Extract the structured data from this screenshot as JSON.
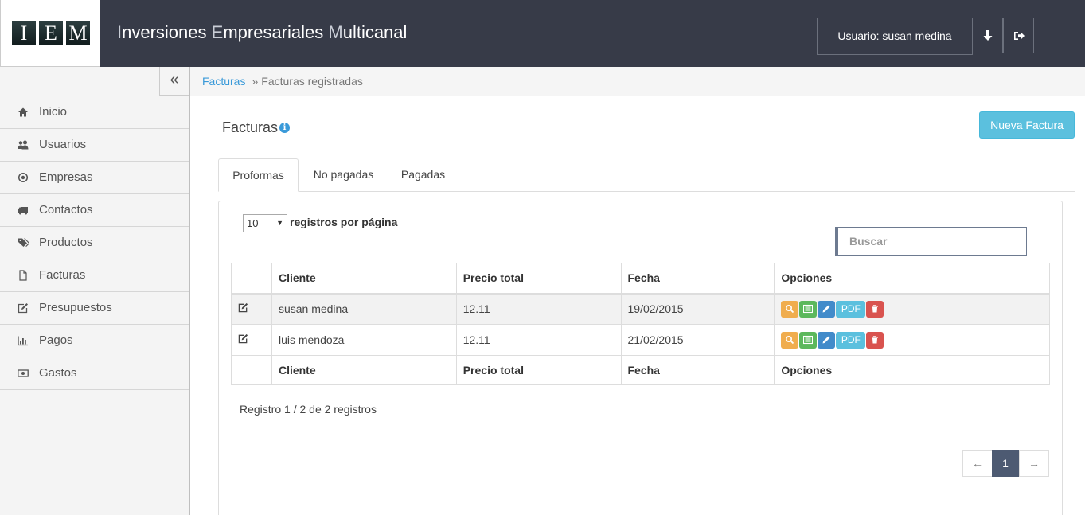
{
  "header": {
    "logo_letters": [
      "I",
      "E",
      "M"
    ],
    "title_parts": [
      {
        "cap": "I",
        "rest": "nversiones "
      },
      {
        "cap": "E",
        "rest": "mpresariales "
      },
      {
        "cap": "M",
        "rest": "ulticanal"
      }
    ],
    "user_label": "Usuario: susan medina",
    "icons": [
      "arrow-down-icon",
      "sign-out-icon"
    ]
  },
  "sidebar": {
    "collapse_icon": "«",
    "items": [
      {
        "label": "Inicio",
        "icon": "home-icon"
      },
      {
        "label": "Usuarios",
        "icon": "users-icon"
      },
      {
        "label": "Empresas",
        "icon": "dot-circle-icon"
      },
      {
        "label": "Contactos",
        "icon": "truck-icon"
      },
      {
        "label": "Productos",
        "icon": "tags-icon"
      },
      {
        "label": "Facturas",
        "icon": "file-icon"
      },
      {
        "label": "Presupuestos",
        "icon": "edit-icon"
      },
      {
        "label": "Pagos",
        "icon": "bar-chart-icon"
      },
      {
        "label": "Gastos",
        "icon": "money-icon"
      }
    ]
  },
  "breadcrumb": {
    "link": "Facturas",
    "separator": "»",
    "current": "Facturas registradas"
  },
  "page": {
    "title": "Facturas",
    "info_icon": "i",
    "new_button": "Nueva Factura"
  },
  "tabs": [
    {
      "label": "Proformas",
      "active": true
    },
    {
      "label": "No pagadas",
      "active": false
    },
    {
      "label": "Pagadas",
      "active": false
    }
  ],
  "table_controls": {
    "page_length": "10",
    "page_length_label": "registros por página",
    "search_placeholder": "Buscar"
  },
  "table": {
    "columns": [
      "",
      "Cliente",
      "Precio total",
      "Fecha",
      "Opciones"
    ],
    "rows": [
      {
        "cliente": "susan medina",
        "precio": "12.11",
        "fecha": "19/02/2015"
      },
      {
        "cliente": "luis mendoza",
        "precio": "12.11",
        "fecha": "21/02/2015"
      }
    ],
    "option_buttons": [
      {
        "name": "view",
        "icon": "search-icon",
        "color": "#f0ad4e"
      },
      {
        "name": "list",
        "icon": "list-icon",
        "color": "#5cb85c"
      },
      {
        "name": "edit",
        "icon": "pencil-icon",
        "color": "#428bca"
      },
      {
        "name": "pdf",
        "label": "PDF",
        "color": "#5bc0de"
      },
      {
        "name": "delete",
        "icon": "trash-icon",
        "color": "#d9534f"
      }
    ]
  },
  "footer_info": "Registro 1 / 2 de 2 registros",
  "pagination": {
    "prev": "←",
    "current": "1",
    "next": "→"
  }
}
